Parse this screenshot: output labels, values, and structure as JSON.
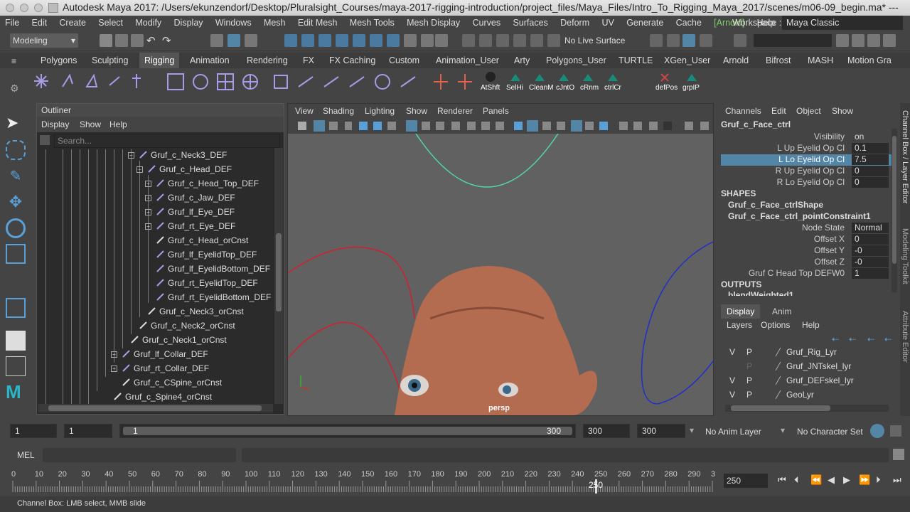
{
  "window": {
    "title": "Autodesk Maya 2017: /Users/ekunzendorf/Desktop/Pluralsight_Courses/maya-2017-rigging-introduction/project_files/Maya_Files/Intro_To_Rigging_Maya_2017/scenes/m06-09_begin.ma*  ---"
  },
  "menubar": {
    "items": [
      "File",
      "Edit",
      "Create",
      "Select",
      "Modify",
      "Display",
      "Windows",
      "Mesh",
      "Edit Mesh",
      "Mesh Tools",
      "Mesh Display",
      "Curves",
      "Surfaces",
      "Deform",
      "UV",
      "Generate",
      "Cache",
      "[Arnold]",
      "Help"
    ],
    "workspace_label": "Workspace :",
    "workspace_value": "Maya Classic"
  },
  "statusline": {
    "mode": "Modeling",
    "live_surface": "No Live Surface"
  },
  "shelf_tabs": [
    "Polygons",
    "Sculpting",
    "Rigging",
    "Animation",
    "Rendering",
    "FX",
    "FX Caching",
    "Custom",
    "Animation_User",
    "Arty",
    "Polygons_User",
    "TURTLE",
    "XGen_User",
    "Arnold",
    "Bifrost",
    "MASH",
    "Motion Gra"
  ],
  "shelf_active": "Rigging",
  "shelf_buttons": [
    "AtShft",
    "SelHi",
    "CleanM",
    "cJntO",
    "cRnm",
    "ctrlCr",
    "defPos",
    "grpIP"
  ],
  "outliner": {
    "title": "Outliner",
    "menu": [
      "Display",
      "Show",
      "Help"
    ],
    "search_placeholder": "Search...",
    "rows": [
      {
        "label": "Gruf_c_Neck3_DEF"
      },
      {
        "label": "Gruf_c_Head_DEF"
      },
      {
        "label": "Gruf_c_Head_Top_DEF"
      },
      {
        "label": "Gruf_c_Jaw_DEF"
      },
      {
        "label": "Gruf_lf_Eye_DEF"
      },
      {
        "label": "Gruf_rt_Eye_DEF"
      },
      {
        "label": "Gruf_c_Head_orCnst"
      },
      {
        "label": "Gruf_lf_EyelidTop_DEF"
      },
      {
        "label": "Gruf_lf_EyelidBottom_DEF"
      },
      {
        "label": "Gruf_rt_EyelidTop_DEF"
      },
      {
        "label": "Gruf_rt_EyelidBottom_DEF"
      },
      {
        "label": "Gruf_c_Neck3_orCnst"
      },
      {
        "label": "Gruf_c_Neck2_orCnst"
      },
      {
        "label": "Gruf_c_Neck1_orCnst"
      },
      {
        "label": "Gruf_lf_Collar_DEF"
      },
      {
        "label": "Gruf_rt_Collar_DEF"
      },
      {
        "label": "Gruf_c_CSpine_orCnst"
      },
      {
        "label": "Gruf_c_Spine4_orCnst"
      }
    ]
  },
  "viewport": {
    "menu": [
      "View",
      "Shading",
      "Lighting",
      "Show",
      "Renderer",
      "Panels"
    ],
    "camera_label": "persp"
  },
  "channel_box": {
    "menu": [
      "Channels",
      "Edit",
      "Object",
      "Show"
    ],
    "node": "Gruf_c_Face_ctrl",
    "attrs": [
      {
        "label": "Visibility",
        "value": "on"
      },
      {
        "label": "L Up Eyelid Op Cl",
        "value": "0.1"
      },
      {
        "label": "L Lo Eyelid Op Cl",
        "value": "7.5"
      },
      {
        "label": "R Up Eyelid Op Cl",
        "value": "0"
      },
      {
        "label": "R Lo Eyelid Op Cl",
        "value": "0"
      }
    ],
    "shapes_header": "SHAPES",
    "shapes": [
      "Gruf_c_Face_ctrlShape",
      "Gruf_c_Face_ctrl_pointConstraint1"
    ],
    "shape_attrs": [
      {
        "label": "Node State",
        "value": "Normal"
      },
      {
        "label": "Offset X",
        "value": "0"
      },
      {
        "label": "Offset Y",
        "value": "-0"
      },
      {
        "label": "Offset Z",
        "value": "-0"
      },
      {
        "label": "Gruf C Head Top DEFW0",
        "value": "1"
      }
    ],
    "outputs_header": "OUTPUTS",
    "outputs_first": "blendWeighted1"
  },
  "side_tabs": [
    "Channel Box / Layer Editor",
    "Modeling Toolkit",
    "Attribute Editor"
  ],
  "layer_editor": {
    "tabs": [
      "Display",
      "Anim"
    ],
    "menu": [
      "Layers",
      "Options",
      "Help"
    ],
    "layers": [
      {
        "v": "V",
        "p": "P",
        "name": "Gruf_Rig_Lyr"
      },
      {
        "v": "",
        "p": "P",
        "name": "Gruf_JNTskel_lyr"
      },
      {
        "v": "V",
        "p": "P",
        "name": "Gruf_DEFskel_lyr"
      },
      {
        "v": "V",
        "p": "P",
        "name": "GeoLyr"
      }
    ]
  },
  "range": {
    "start": "1",
    "anim_start": "1",
    "slider_start": "1",
    "slider_end": "300",
    "anim_end": "300",
    "end": "300",
    "anim_layer": "No Anim Layer",
    "char_set": "No Character Set"
  },
  "mel": {
    "label": "MEL"
  },
  "timeline": {
    "ticks": [
      "0",
      "10",
      "20",
      "30",
      "40",
      "50",
      "60",
      "70",
      "80",
      "90",
      "100",
      "110",
      "120",
      "130",
      "140",
      "150",
      "160",
      "170",
      "180",
      "190",
      "200",
      "210",
      "220",
      "230",
      "240",
      "250",
      "260",
      "270",
      "280",
      "290",
      "3"
    ],
    "current": "250",
    "current_field": "250"
  },
  "help_line": "Channel Box: LMB select, MMB slide",
  "colors": {
    "accent": "#5285a6",
    "selection": "#5285a6",
    "bg": "#444444"
  }
}
